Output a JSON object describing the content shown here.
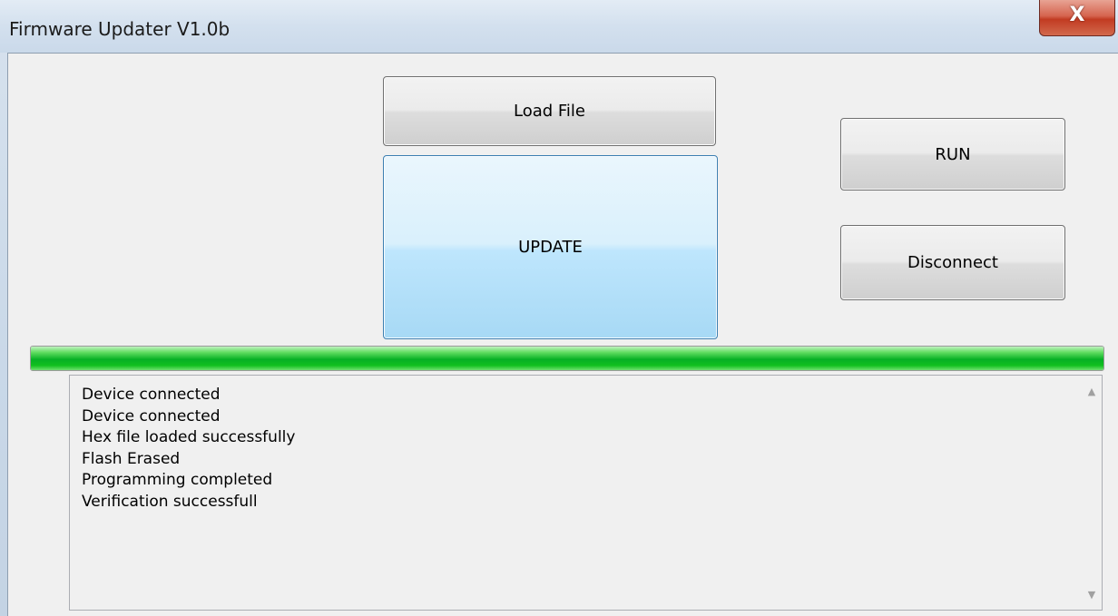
{
  "window": {
    "title": "Firmware Updater V1.0b",
    "close_glyph": "X"
  },
  "buttons": {
    "load_file": "Load File",
    "update": "UPDATE",
    "run": "RUN",
    "disconnect": "Disconnect"
  },
  "progress": {
    "value_fraction": 1.0,
    "color": "#06b025"
  },
  "log": {
    "lines": [
      "Device connected",
      "Device connected",
      "Hex file loaded successfully",
      "Flash Erased",
      "Programming completed",
      "Verification successfull"
    ],
    "scroll_up_icon": "▲",
    "scroll_down_icon": "▼"
  },
  "icons": {
    "close": "close-icon",
    "scroll_up": "scroll-up-icon",
    "scroll_down": "scroll-down-icon"
  },
  "colors": {
    "update_button": "#bee6fd",
    "close_button": "#c23b22",
    "client_bg": "#f0f0f0"
  }
}
